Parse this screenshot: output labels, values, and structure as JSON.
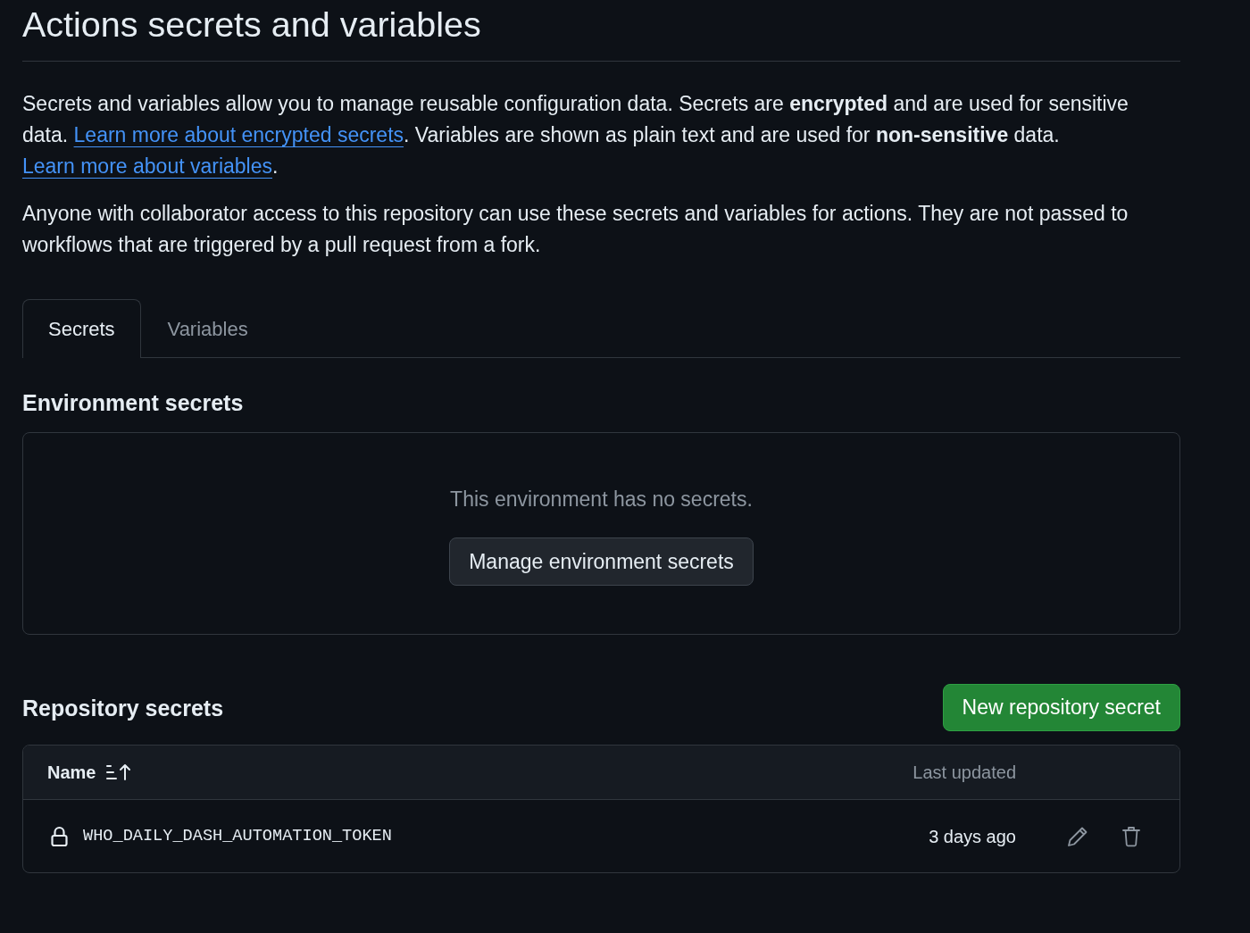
{
  "page": {
    "title": "Actions secrets and variables"
  },
  "description": [
    {
      "parts": [
        {
          "kind": "text",
          "text": "Secrets and variables allow you to manage reusable configuration data. Secrets are **encrypted** and are used for sensitive data. "
        },
        {
          "kind": "link",
          "text": "Learn more about encrypted secrets"
        },
        {
          "kind": "text",
          "text": ". Variables are shown as plain text and are used for **non-sensitive** data. "
        },
        {
          "kind": "link",
          "text": "Learn more about variables"
        },
        {
          "kind": "text",
          "text": "."
        }
      ]
    },
    {
      "parts": [
        {
          "kind": "text",
          "text": "Anyone with collaborator access to this repository can use these secrets and variables for actions. They are not passed to workflows that are triggered by a pull request from a fork."
        }
      ]
    }
  ],
  "tabs": [
    {
      "label": "Secrets",
      "selected": true
    },
    {
      "label": "Variables",
      "selected": false
    }
  ],
  "environment_secrets": {
    "heading": "Environment secrets",
    "empty_message": "This environment has no secrets.",
    "button": "Manage environment secrets"
  },
  "repository_secrets": {
    "heading": "Repository secrets",
    "new_button": "New repository secret",
    "table": {
      "columns": [
        {
          "label": "Name",
          "sorted": true
        },
        {
          "label": "Last updated",
          "sorted": false
        }
      ],
      "rows": [
        {
          "name": "WHO_DAILY_DASH_AUTOMATION_TOKEN",
          "last_updated": "3 days ago"
        }
      ]
    }
  }
}
